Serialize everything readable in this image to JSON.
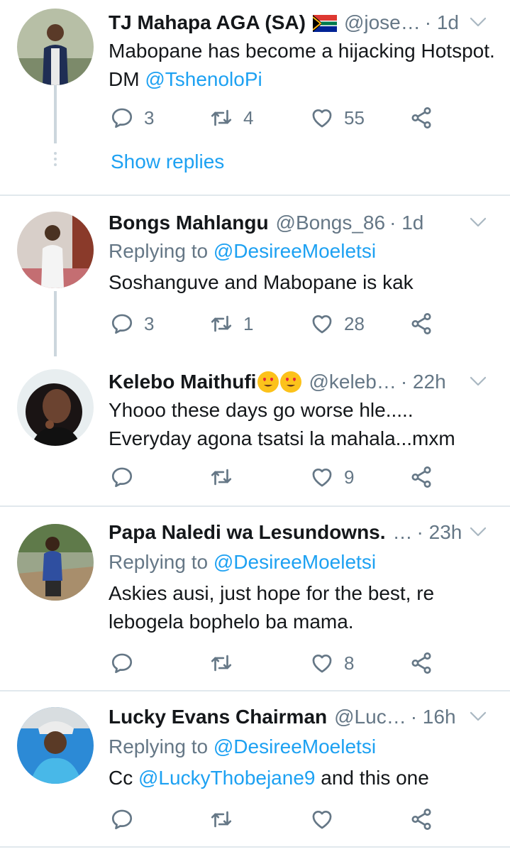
{
  "tweets": [
    {
      "name": "TJ Mahapa AGA (SA)",
      "handle": "@jose…",
      "time": "· 1d",
      "text_parts": [
        "Mabopane has become a hijacking Hotspot. DM ",
        "@TshenoloPi"
      ],
      "reply_count": "3",
      "retweet_count": "4",
      "like_count": "55",
      "show_replies": "Show replies",
      "flag": "south-africa-flag-icon"
    },
    {
      "name": "Bongs Mahlangu",
      "handle": "@Bongs_86",
      "time": "· 1d",
      "replying_label": "Replying to ",
      "replying_handle": "@DesireeMoeletsi",
      "text": "Soshanguve and Mabopane is kak",
      "reply_count": "3",
      "retweet_count": "1",
      "like_count": "28"
    },
    {
      "name": "Kelebo Maithufi",
      "handle": "@keleb…",
      "time": "· 22h",
      "emojis": [
        "heart-eyes-emoji",
        "heart-eyes-emoji"
      ],
      "text_line1": "Yhooo these days go worse hle.....",
      "text_line2": "Everyday agona tsatsi la mahala...mxm",
      "reply_count": "",
      "retweet_count": "",
      "like_count": "9"
    },
    {
      "name": "Papa Naledi wa Lesundowns.",
      "handle": "…",
      "time": "· 23h",
      "replying_label": "Replying to ",
      "replying_handle": "@DesireeMoeletsi",
      "text_line1": "Askies ausi, just hope for the best, re",
      "text_line2": "lebogela bophelo ba mama.",
      "reply_count": "",
      "retweet_count": "",
      "like_count": "8"
    },
    {
      "name": "Lucky Evans Chairman",
      "handle": "@Luc…",
      "time": "· 16h",
      "replying_label": "Replying to ",
      "replying_handle": "@DesireeMoeletsi",
      "text_parts": [
        "Cc ",
        "@LuckyThobejane9",
        " and this one"
      ],
      "reply_count": "",
      "retweet_count": "",
      "like_count": ""
    }
  ],
  "colors": {
    "link": "#1da1f2",
    "muted": "#657786",
    "text": "#14171a",
    "divider": "#e1e8ed"
  },
  "icons": [
    "reply-icon",
    "retweet-icon",
    "like-icon",
    "share-icon",
    "caret-down-icon"
  ]
}
